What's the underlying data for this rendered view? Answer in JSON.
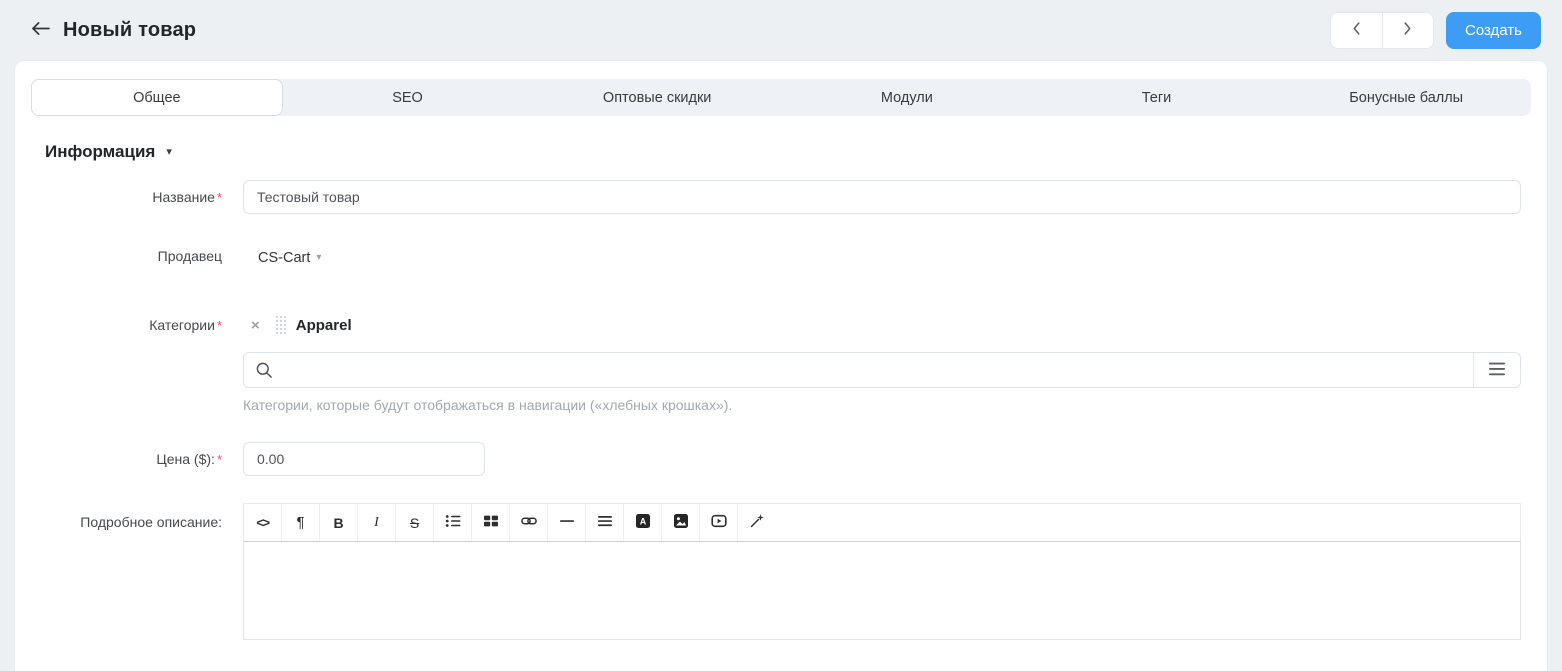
{
  "header": {
    "title": "Новый товар",
    "create_button": "Создать"
  },
  "tabs": [
    {
      "label": "Общее",
      "active": true
    },
    {
      "label": "SEO",
      "active": false
    },
    {
      "label": "Оптовые скидки",
      "active": false
    },
    {
      "label": "Модули",
      "active": false
    },
    {
      "label": "Теги",
      "active": false
    },
    {
      "label": "Бонусные баллы",
      "active": false
    }
  ],
  "section": {
    "title": "Информация",
    "caret": "▾"
  },
  "required_mark": "*",
  "form": {
    "name": {
      "label": "Название",
      "value": "Тестовый товар"
    },
    "vendor": {
      "label": "Продавец",
      "value": "CS-Cart",
      "caret": "▾"
    },
    "categories": {
      "label": "Категории",
      "selected": "Apparel",
      "remove_glyph": "×",
      "search_value": "",
      "help": "Категории, которые будут отображаться в навигации («хлебных крошках»)."
    },
    "price": {
      "label": "Цена ($):",
      "value": "0.00"
    },
    "description": {
      "label": "Подробное описание:",
      "value": ""
    }
  },
  "editor": {
    "glyphs": {
      "code": "<>",
      "paragraph": "¶",
      "bold": "B",
      "italic": "I",
      "strike": "S"
    },
    "icons": [
      "code",
      "paragraph",
      "bold",
      "italic",
      "strikethrough",
      "bullet-list",
      "blocks",
      "link",
      "horizontal-rule",
      "align",
      "text-block",
      "image",
      "video",
      "magic-wand"
    ]
  },
  "colors": {
    "accent_blue": "#3d9df5",
    "asterisk_red": "#f0506e",
    "card_bg": "#ffffff",
    "page_bg": "#edf0f3"
  }
}
